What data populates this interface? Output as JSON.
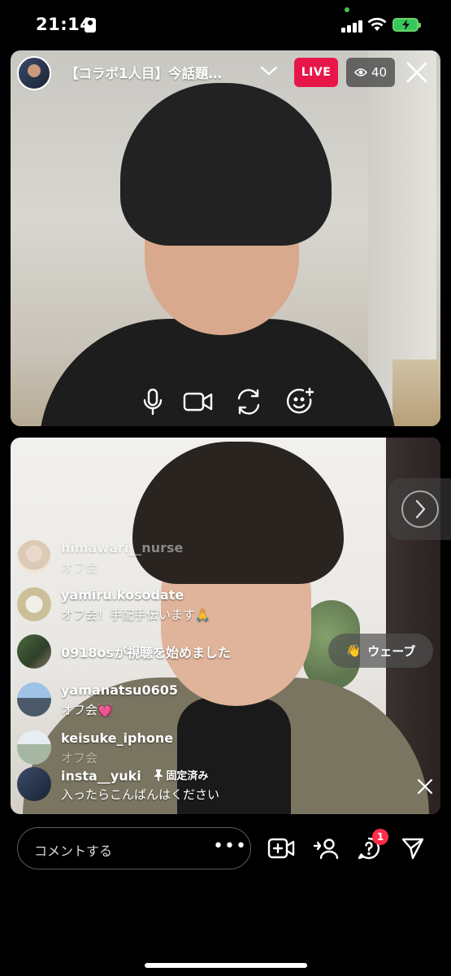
{
  "status_bar": {
    "time": "21:14"
  },
  "header": {
    "title": "【コラボ1人目】今話題…",
    "live_label": "LIVE",
    "viewer_count": "40"
  },
  "comments": [
    {
      "user": "himawari__nurse",
      "text": "オフ会"
    },
    {
      "user": "yamiru.kosodate",
      "text": "オフ会！手配手伝います🙏"
    },
    {
      "join_text": "0918osが視聴を始めました"
    },
    {
      "user": "yamanatsu0605",
      "text": "オフ会💓"
    },
    {
      "user": "keisuke_iphone",
      "text": "オフ会"
    },
    {
      "user": "insta__yuki",
      "pinned_label": "固定済み",
      "text": "入ったらこんばんはください"
    }
  ],
  "wave_button": {
    "label": "ウェーブ",
    "emoji": "👋"
  },
  "comment_input": {
    "placeholder": "コメントする",
    "more": "•••"
  },
  "notifications": {
    "questions_badge": "1"
  },
  "colors": {
    "live_red": "#e8174a",
    "badge_red": "#ff2d4b",
    "battery_green": "#35c759"
  }
}
